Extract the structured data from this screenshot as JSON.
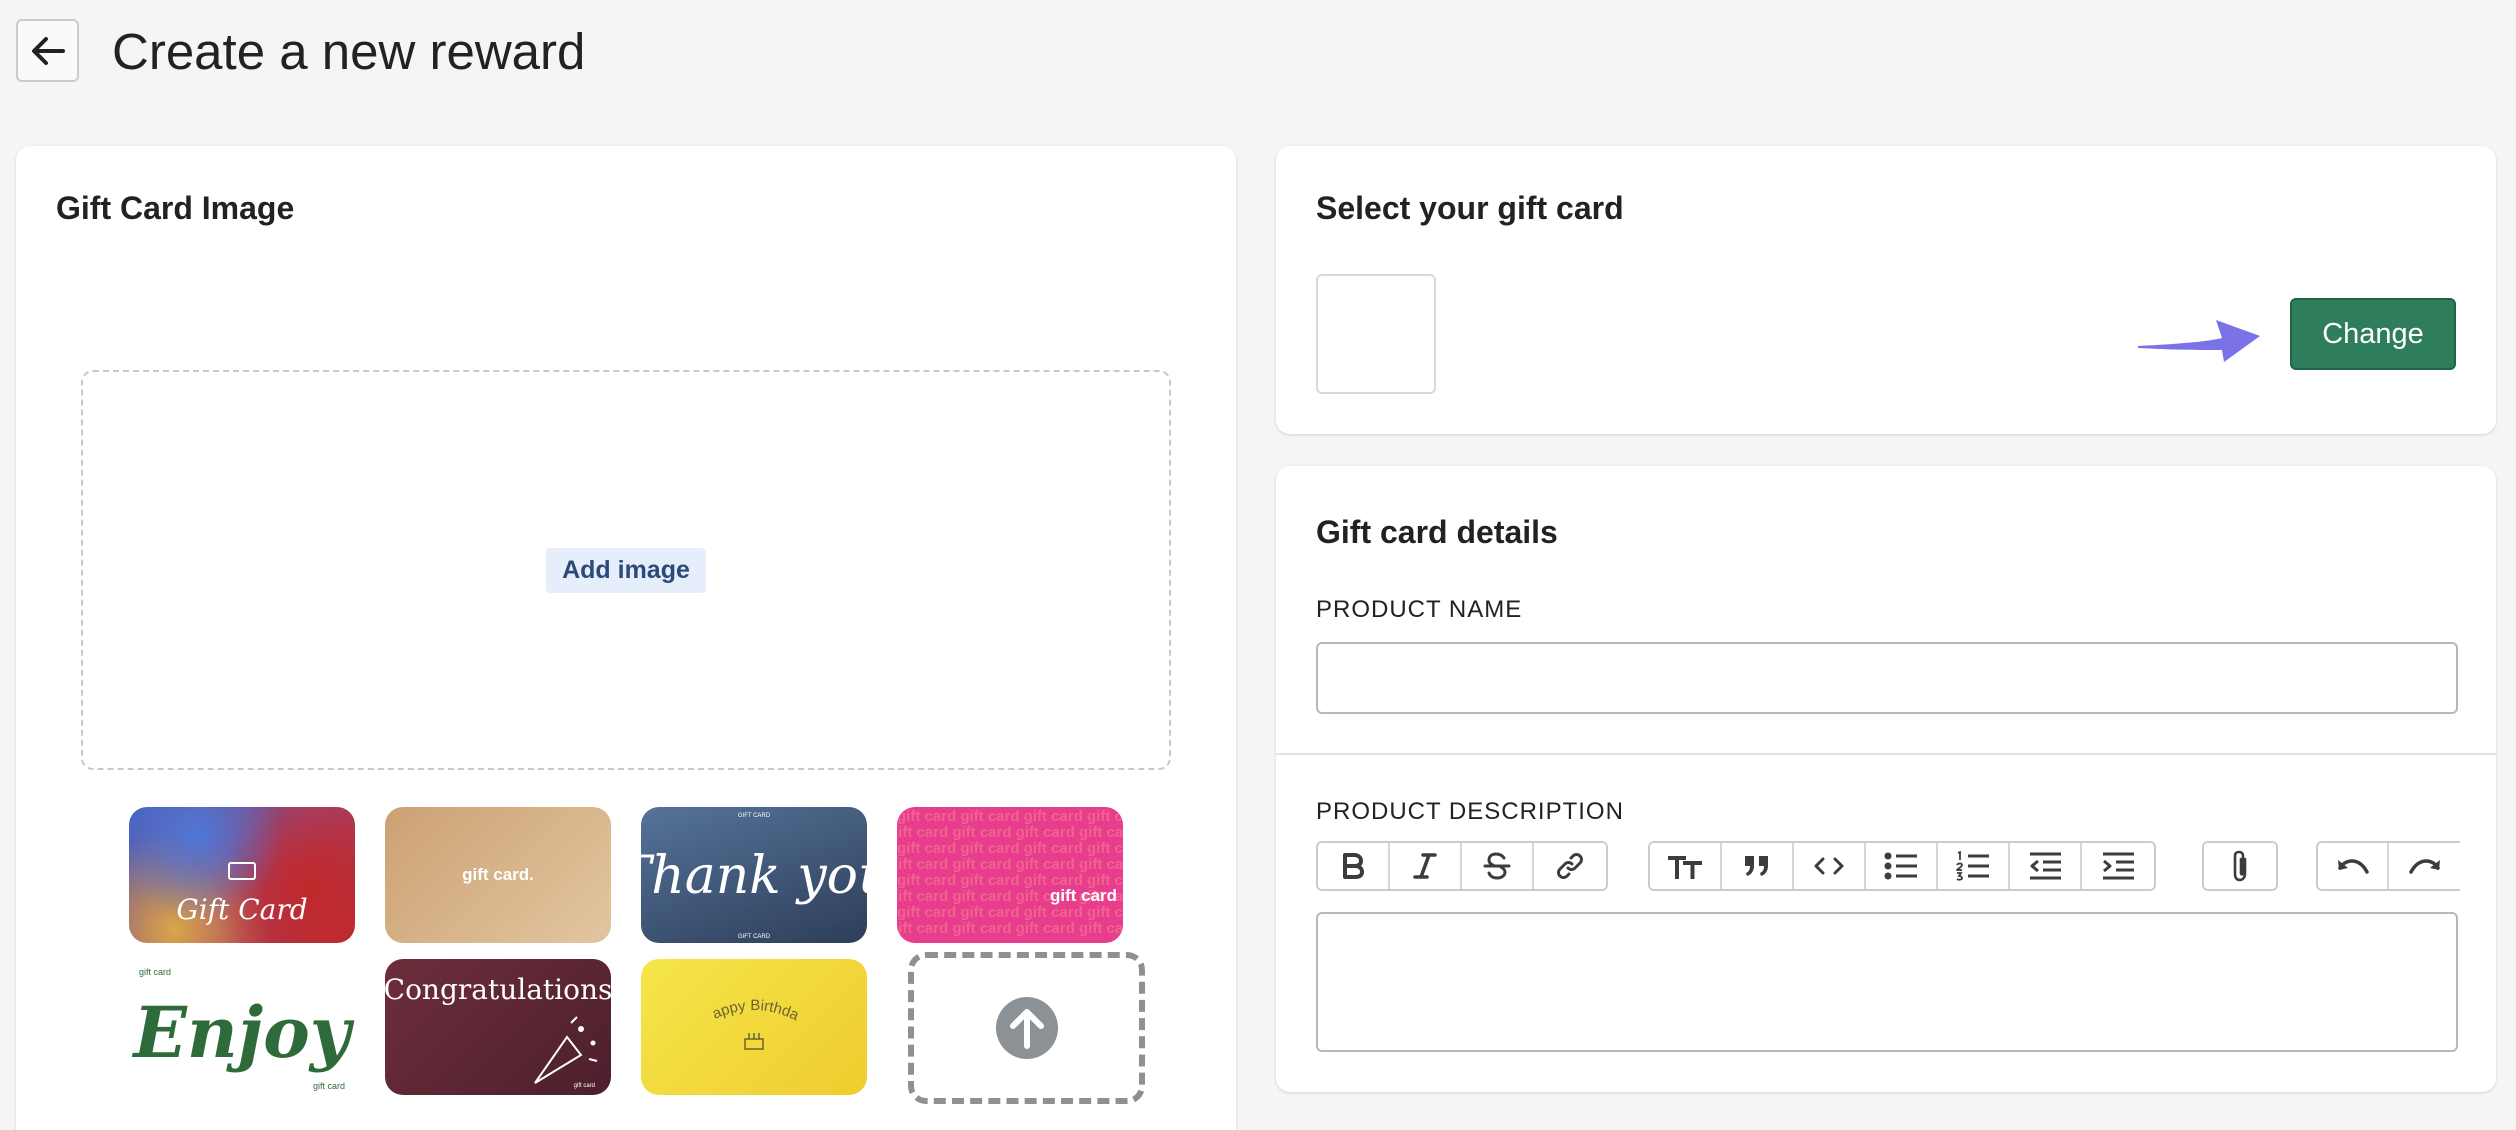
{
  "header": {
    "back_icon": "arrow-left-icon",
    "title": "Create a new reward"
  },
  "gift_card_image": {
    "heading": "Gift Card Image",
    "add_image_label": "Add image",
    "templates": [
      {
        "name": "gift-card-gradient",
        "text": "Gift Card"
      },
      {
        "name": "gift-card-tan",
        "text": "gift card."
      },
      {
        "name": "thank-you",
        "text": "Thank you",
        "small_text": "GIFT CARD"
      },
      {
        "name": "gift-card-pink",
        "text": "gift card",
        "pattern_text": "gift card gift card gift card gift card gift card"
      },
      {
        "name": "enjoy",
        "text": "Enjoy",
        "small_text": "gift card"
      },
      {
        "name": "congratulations",
        "text": "Congratulations",
        "small_text": "gift card"
      },
      {
        "name": "happy-birthday",
        "text": "Happy Birthday"
      }
    ],
    "upload_icon": "arrow-up-circle-icon"
  },
  "select_gift_card": {
    "heading": "Select your gift card",
    "change_label": "Change"
  },
  "gift_card_details": {
    "heading": "Gift card details",
    "product_name_label": "PRODUCT NAME",
    "product_name_value": "",
    "product_description_label": "PRODUCT DESCRIPTION",
    "toolbar": [
      [
        "bold-icon",
        "italic-icon",
        "strikethrough-icon",
        "link-icon"
      ],
      [
        "heading-icon",
        "quote-icon",
        "code-icon",
        "bullet-list-icon",
        "numbered-list-icon",
        "decrease-indent-icon",
        "increase-indent-icon"
      ],
      [
        "attach-icon"
      ],
      [
        "undo-icon",
        "redo-icon"
      ]
    ]
  },
  "colors": {
    "primary_button": "#2e7d5b",
    "hint_arrow": "#7b72e8",
    "add_image_bg": "#e7eefb"
  }
}
